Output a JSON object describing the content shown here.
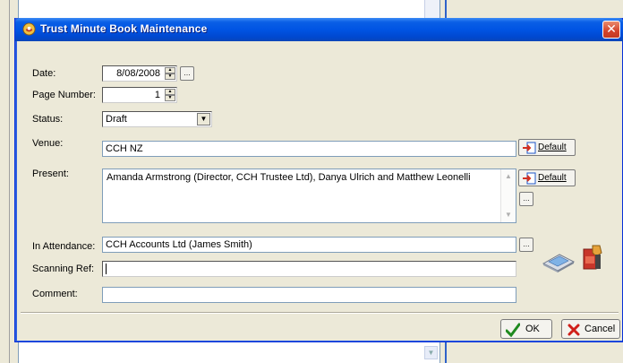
{
  "window": {
    "title": "Trust Minute Book Maintenance",
    "close_glyph": "✕"
  },
  "labels": {
    "date": "Date:",
    "page_number": "Page Number:",
    "status": "Status:",
    "venue": "Venue:",
    "present": "Present:",
    "in_attendance": "In Attendance:",
    "scanning_ref": "Scanning Ref:",
    "comment": "Comment:"
  },
  "fields": {
    "date": "8/08/2008",
    "page_number": "1",
    "status": "Draft",
    "venue": "CCH NZ",
    "present": "Amanda Armstrong (Director, CCH Trustee Ltd), Danya Ulrich and Matthew Leonelli",
    "in_attendance": "CCH Accounts Ltd (James Smith)",
    "scanning_ref": "",
    "comment": ""
  },
  "buttons": {
    "ellipsis": "...",
    "default": "Default",
    "ok": "OK",
    "cancel": "Cancel"
  },
  "icons": {
    "title": "trust-app-icon",
    "scanner": "scanner-icon",
    "pdf": "pdf-document-icon",
    "ok": "green-check-icon",
    "cancel": "red-x-icon"
  },
  "colors": {
    "titlebar": "#0054e3",
    "dialog_bg": "#ece9d8",
    "field_border": "#7f9db9"
  }
}
